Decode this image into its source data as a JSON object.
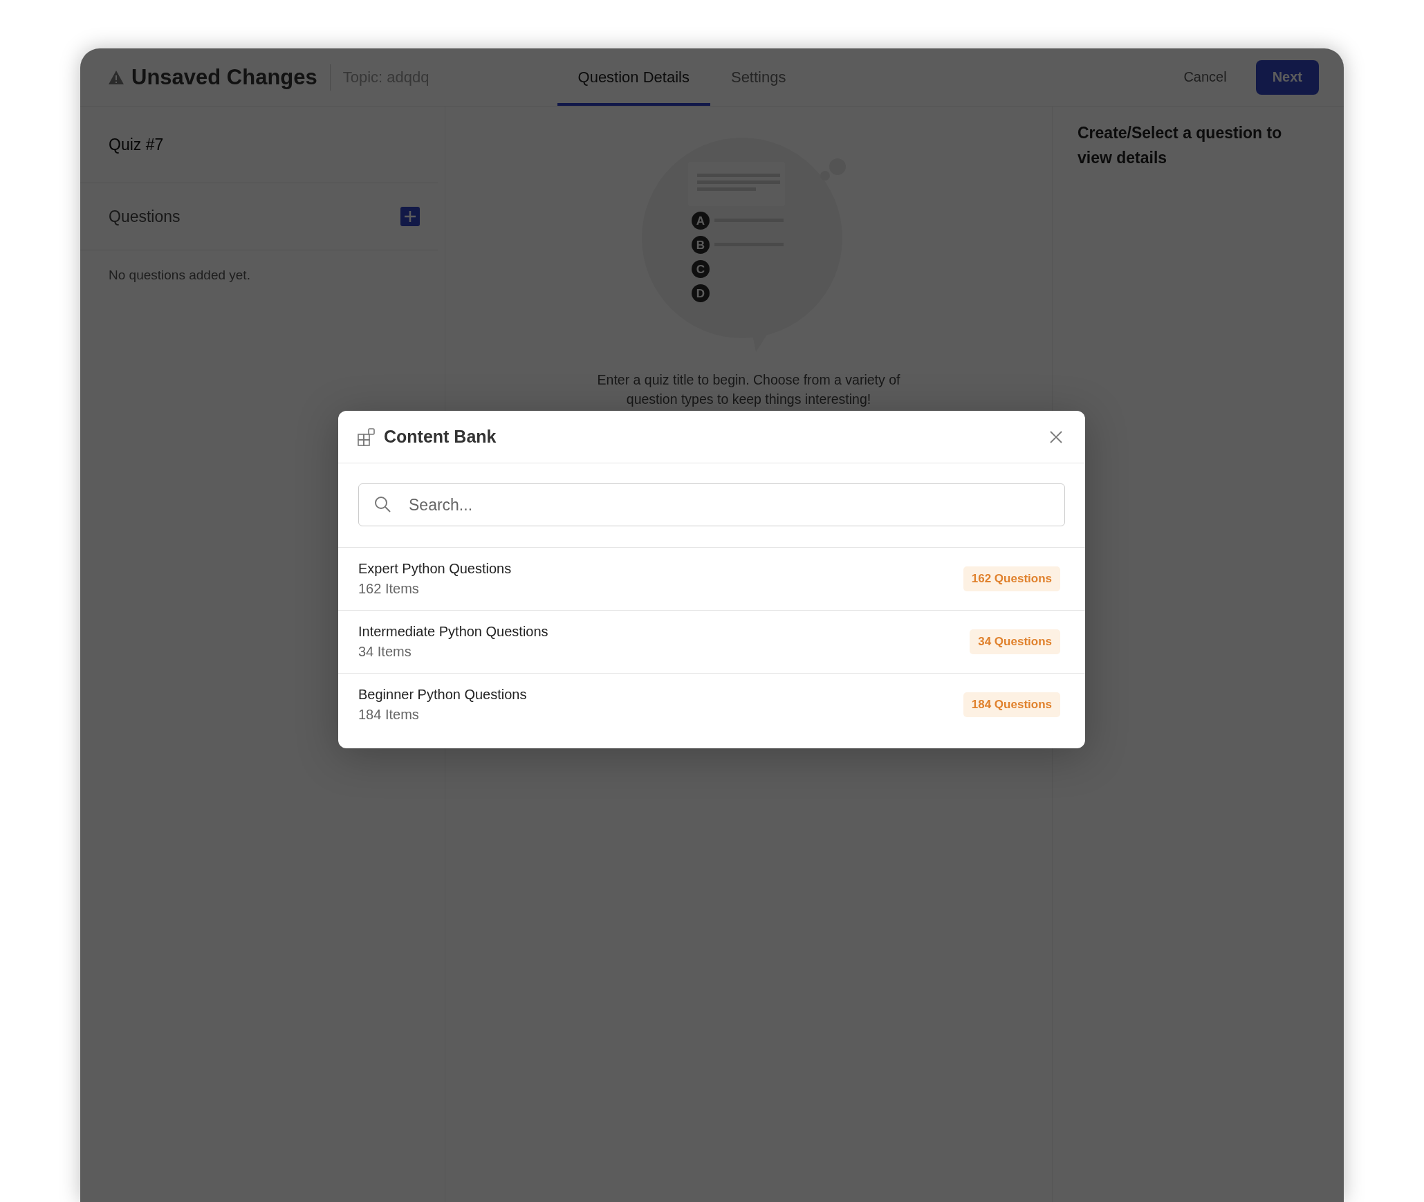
{
  "header": {
    "title": "Unsaved Changes",
    "topic": "Topic: adqdq",
    "tabs": [
      {
        "label": "Question Details",
        "selected": true
      },
      {
        "label": "Settings",
        "selected": false
      }
    ],
    "cancel": "Cancel",
    "next": "Next"
  },
  "sidebar": {
    "quiz_title": "Quiz #7",
    "section": "Questions",
    "empty": "No questions added yet."
  },
  "center": {
    "option_letters": [
      "A",
      "B",
      "C",
      "D"
    ],
    "hint": "Enter a quiz title to begin. Choose from a variety of question types to keep things interesting!"
  },
  "details": {
    "message": "Create/Select a question to view details"
  },
  "modal": {
    "title": "Content Bank",
    "search": {
      "placeholder": "Search..."
    },
    "items": [
      {
        "name": "Expert Python Questions",
        "count": "162 Items",
        "badge": "162 Questions"
      },
      {
        "name": "Intermediate Python Questions",
        "count": "34 Items",
        "badge": "34 Questions"
      },
      {
        "name": "Beginner Python Questions",
        "count": "184 Items",
        "badge": "184 Questions"
      }
    ]
  }
}
